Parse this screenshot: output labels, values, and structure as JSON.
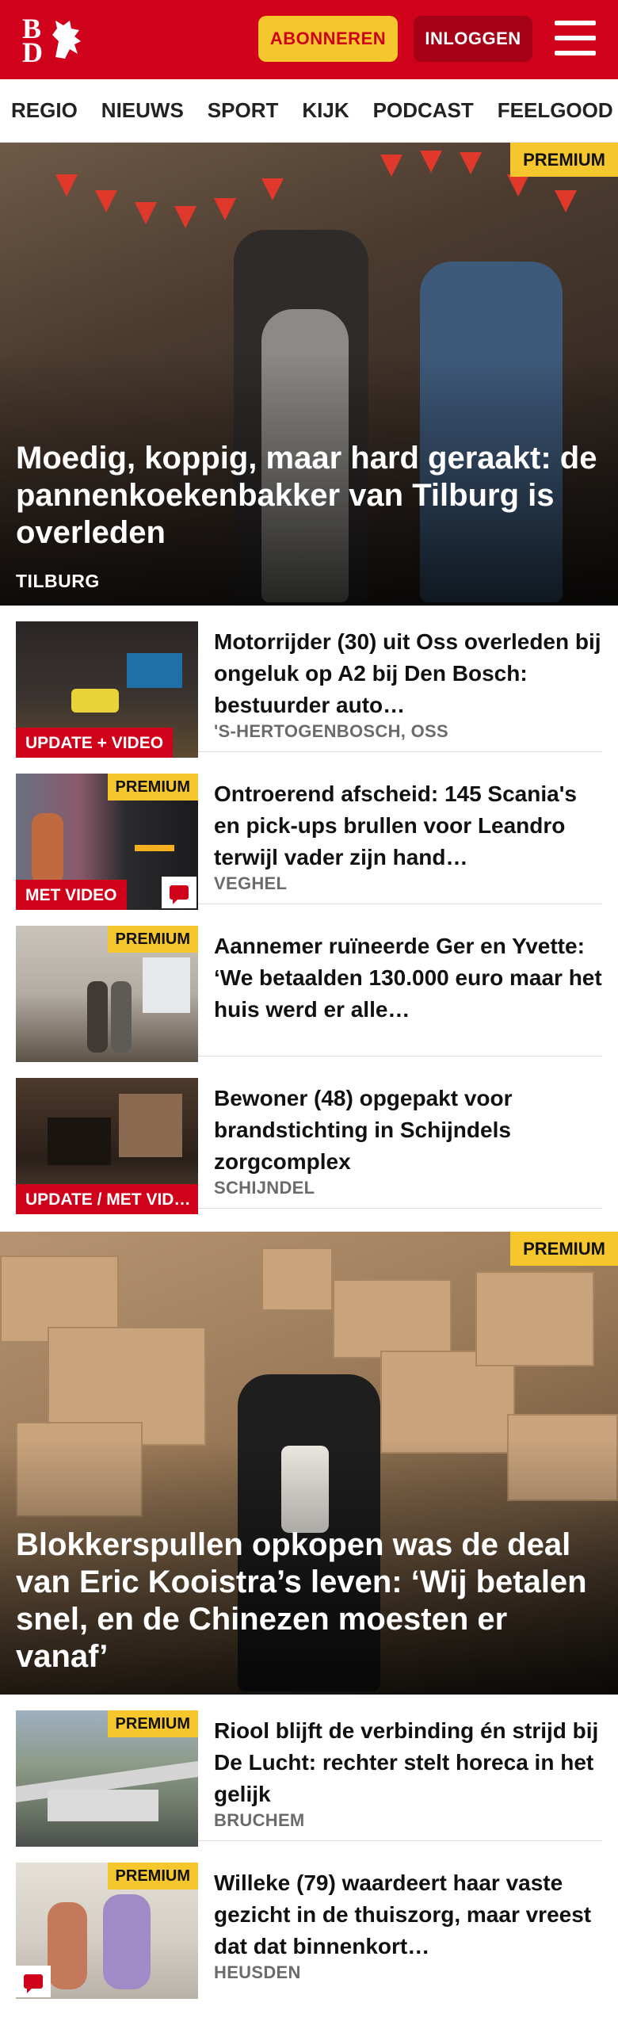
{
  "header": {
    "logo_top": "B",
    "logo_bottom": "D",
    "subscribe_label": "ABONNEREN",
    "login_label": "INLOGGEN",
    "menu_icon": "hamburger-icon",
    "brand_color": "#d0021b",
    "accent_color": "#f5c72c"
  },
  "nav": {
    "items": [
      "REGIO",
      "NIEUWS",
      "SPORT",
      "KIJK",
      "PODCAST",
      "FEELGOOD"
    ]
  },
  "hero_1": {
    "badge": "PREMIUM",
    "title": "Moedig, koppig, maar hard geraakt: de pannenkoekenbakker van Tilburg is overleden",
    "location": "TILBURG"
  },
  "articles_1": [
    {
      "title": "Motorrijder (30) uit Oss overleden bij ongeluk op A2 bij Den Bosch: bestuurder auto…",
      "location": "'S-HERTOGENBOSCH, OSS",
      "label": "UPDATE + VIDEO"
    },
    {
      "title": "Ontroerend afscheid: 145 Scania's en pick-ups brullen voor Leandro terwijl vader zijn hand…",
      "location": "VEGHEL",
      "label": "MET VIDEO",
      "badge": "PREMIUM"
    },
    {
      "title": "Aannemer ruïneerde Ger en Yvette: ‘We betaalden 130.000 euro maar het huis werd er alle…",
      "badge": "PREMIUM"
    },
    {
      "title": "Bewoner (48) opgepakt voor brandstichting in Schijndels zorgcomplex",
      "location": "SCHIJNDEL",
      "label": "UPDATE / MET VID…"
    }
  ],
  "hero_2": {
    "badge": "PREMIUM",
    "title": "Blokkerspullen opkopen was de deal van Eric Kooistra’s leven: ‘Wij betalen snel, en de Chinezen moesten er vanaf’"
  },
  "articles_2": [
    {
      "title": "Riool blijft de verbinding én strijd bij De Lucht: rechter stelt horeca in het gelijk",
      "location": "BRUCHEM",
      "badge": "PREMIUM"
    },
    {
      "title": "Willeke (79) waardeert haar vaste gezicht in de thuiszorg, maar vreest dat dat binnenkort…",
      "location": "HEUSDEN",
      "badge": "PREMIUM"
    }
  ]
}
